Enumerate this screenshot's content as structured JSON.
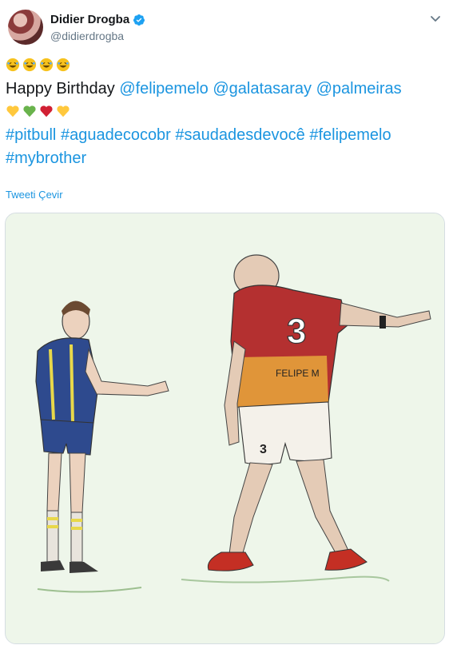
{
  "header": {
    "display_name": "Didier Drogba",
    "handle": "@didierdrogba",
    "verified_icon": "verified-badge-icon",
    "menu_icon": "chevron-down-icon"
  },
  "tweet": {
    "emoji_line": [
      "rolling-on-floor-laughing",
      "rolling-on-floor-laughing",
      "rolling-on-floor-laughing",
      "rolling-on-floor-laughing"
    ],
    "greeting": "Happy Birthday",
    "mentions": [
      "@felipemelo",
      "@galatasaray",
      "@palmeiras"
    ],
    "hearts": [
      "yellow-heart",
      "green-heart",
      "red-heart",
      "yellow-heart"
    ],
    "hashtags_line1": [
      "#pitbull",
      "#aguadecocobr",
      "#saudadesdevocê",
      "#felipemelo"
    ],
    "hashtags_line2": [
      "#mybrother"
    ]
  },
  "translate_label": "Tweeti Çevir",
  "media": {
    "description_icon": "illustration-image",
    "jersey_number": "3",
    "shorts_number": "3",
    "jersey_name": "FELIPE M"
  },
  "colors": {
    "link": "#1b95e0",
    "text": "#14171a",
    "secondary": "#657786",
    "verified": "#1da1f2",
    "emoji_face": "#f7c21d",
    "heart_yellow": "#ffc83d",
    "heart_green": "#69b34c",
    "heart_red": "#d12033"
  }
}
